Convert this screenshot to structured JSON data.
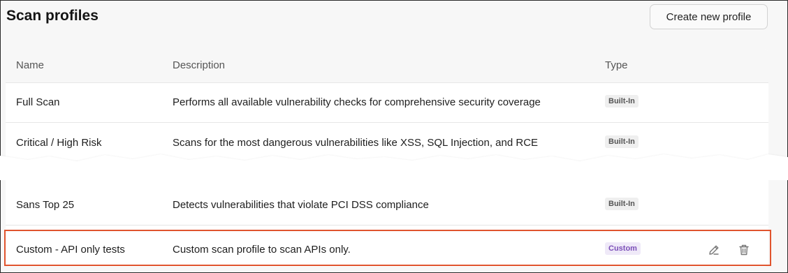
{
  "header": {
    "title": "Scan profiles",
    "create_button_label": "Create new profile"
  },
  "table": {
    "columns": [
      "Name",
      "Description",
      "Type"
    ],
    "rows": [
      {
        "name": "Full Scan",
        "description": "Performs all available vulnerability checks for comprehensive security coverage",
        "type": "Built-In"
      },
      {
        "name": "Critical / High Risk",
        "description": "Scans for the most dangerous vulnerabilities like XSS, SQL Injection, and RCE",
        "type": "Built-In"
      },
      {
        "name": "Sans Top 25",
        "description": "Detects vulnerabilities that violate PCI DSS compliance",
        "type": "Built-In"
      },
      {
        "name": "Custom - API only tests",
        "description": "Custom scan profile to scan APIs only.",
        "type": "Custom"
      }
    ]
  },
  "row_actions": {
    "edit_icon": "pencil-edit-icon",
    "delete_icon": "trash-icon"
  },
  "colors": {
    "highlight_border": "#e0542e",
    "builtin_badge_bg": "#efefef",
    "custom_badge_bg": "#efe9f8",
    "custom_badge_text": "#7b4fb8"
  }
}
